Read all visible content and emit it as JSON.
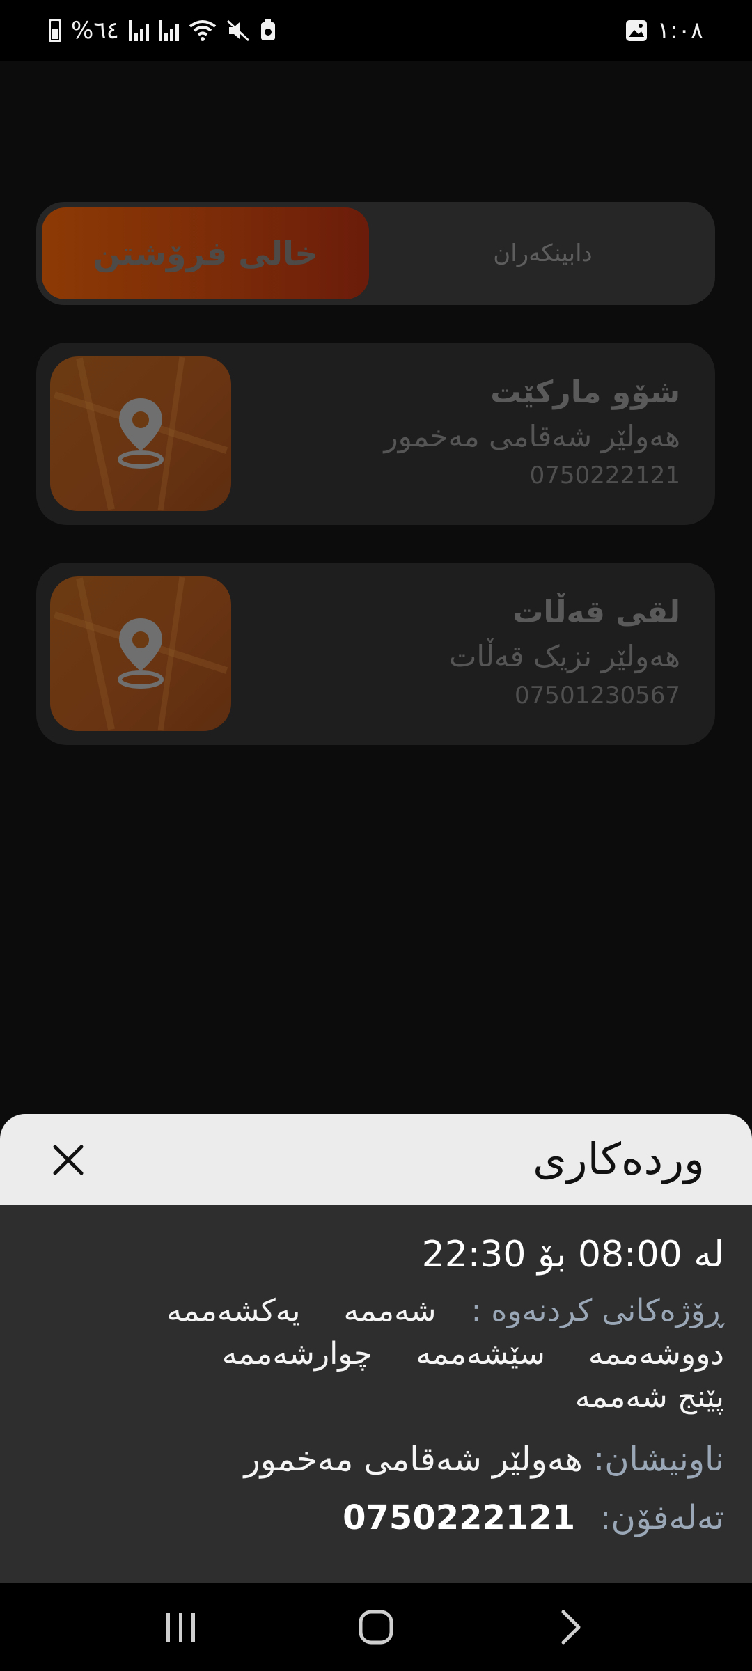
{
  "status_bar": {
    "battery_percent": "%٦٤",
    "time": "١:٠٨"
  },
  "tabs": {
    "active_label": "خالی فرۆشتن",
    "inactive_label": "دابینکەران"
  },
  "stores": [
    {
      "name": "شۆو مارکێت",
      "address": "هەولێر شەقامی مەخمور",
      "phone": "0750222121"
    },
    {
      "name": "لقی قەڵات",
      "address": "هەولێر نزیک قەڵات",
      "phone": "07501230567"
    }
  ],
  "sheet": {
    "title": "وردەکاری",
    "hours": "لە 08:00 بۆ 22:30",
    "days_label": "ڕۆژەکانی کردنەوە :",
    "days": [
      "شەممە",
      "یەکشەممە",
      "دووشەممە",
      "سێشەممە",
      "چوارشەممە",
      "پێنج شەممە"
    ],
    "address_label": "ناونیشان:",
    "address_value": "هەولێر شەقامی مەخمور",
    "phone_label": "تەلەفۆن:",
    "phone_value": "0750222121"
  },
  "colors": {
    "accent": "#8d3a05",
    "sheet_header_bg": "#ececec",
    "sheet_body_bg": "#2e2e2e",
    "label": "#9aa7b6"
  }
}
